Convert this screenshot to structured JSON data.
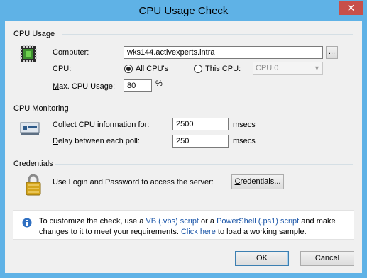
{
  "window": {
    "title": "CPU Usage Check",
    "close_glyph": "✕"
  },
  "cpu_usage": {
    "section_title": "CPU Usage",
    "icon": "cpu-chip-icon",
    "computer_label": "Computer:",
    "computer_value": "wks144.activexperts.intra",
    "browse_label": "...",
    "cpu_label_ul": "C",
    "cpu_label_rest": "PU:",
    "all_cpus_ul": "A",
    "all_cpus_rest": "ll CPU's",
    "this_cpu_ul": "T",
    "this_cpu_rest": "his CPU:",
    "this_cpu_select": "CPU 0",
    "selected": "all",
    "max_label_ul": "M",
    "max_label_rest": "ax. CPU Usage:",
    "max_value": "80",
    "max_unit": "%"
  },
  "cpu_monitoring": {
    "section_title": "CPU Monitoring",
    "icon": "monitoring-gauge-icon",
    "collect_ul": "C",
    "collect_rest": "ollect CPU information for:",
    "collect_value": "2500",
    "collect_unit": "msecs",
    "delay_ul": "D",
    "delay_rest": "elay between each poll:",
    "delay_value": "250",
    "delay_unit": "msecs"
  },
  "credentials": {
    "section_title": "Credentials",
    "icon": "padlock-icon",
    "text": "Use Login and Password to access the server:",
    "button_ul": "C",
    "button_rest": "redentials..."
  },
  "info": {
    "icon": "info-icon",
    "text_1": "To customize the check, use a ",
    "link_vb": "VB (.vbs) script",
    "text_2": " or a ",
    "link_ps": "PowerShell (.ps1) script",
    "text_3": " and make changes to it to meet your requirements. ",
    "link_here": "Click here",
    "text_4": " to load a working sample."
  },
  "footer": {
    "ok_label": "OK",
    "cancel_label": "Cancel"
  },
  "colors": {
    "title_bar": "#5fb2e6",
    "close_button": "#c7504a",
    "link": "#1a55a8",
    "client_bg": "#f0f0f0"
  }
}
